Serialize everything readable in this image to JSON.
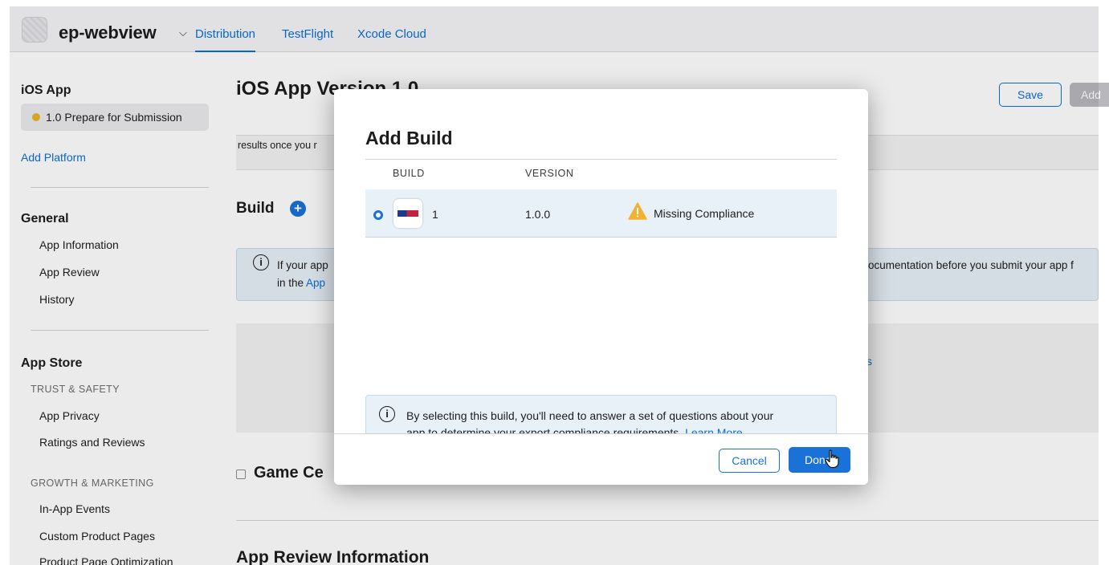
{
  "topbar": {
    "app_name": "ep-webview",
    "chevron": "⌵",
    "tabs": [
      {
        "label": "Distribution",
        "active": true
      },
      {
        "label": "TestFlight",
        "active": false
      },
      {
        "label": "Xcode Cloud",
        "active": false
      }
    ]
  },
  "sidebar": {
    "section_title": "iOS App",
    "status": "1.0 Prepare for Submission",
    "add_platform": "Add Platform",
    "general_title": "General",
    "general_items": [
      "App Information",
      "App Review",
      "History"
    ],
    "appstore_title": "App Store",
    "trust_caption": "TRUST & SAFETY",
    "trust_items": [
      "App Privacy",
      "Ratings and Reviews"
    ],
    "growth_caption": "GROWTH & MARKETING",
    "growth_items": [
      "In-App Events",
      "Custom Product Pages",
      "Product Page Optimization"
    ]
  },
  "main": {
    "title": "iOS App Version 1.0",
    "save_label": "Save",
    "add_label": "Add",
    "results_text": "results once you r",
    "build_heading": "Build",
    "build_plus": "+",
    "banner_line1_left": "If your app",
    "banner_line1_right": "ocumentation before you submit your app f",
    "banner_line2_prefix": "in the",
    "banner_line2_link": "App",
    "panel_link": "s",
    "game_center": "Game Ce",
    "app_review_info": "App Review Information"
  },
  "modal": {
    "title": "Add Build",
    "col_build": "BUILD",
    "col_version": "VERSION",
    "row": {
      "build": "1",
      "version": "1.0.0",
      "status": "Missing Compliance"
    },
    "info_line1": "By selecting this build, you'll need to answer a set of questions about your",
    "info_line2_prefix": "app to determine your export compliance requirements.",
    "info_link": "Learn More",
    "cancel_label": "Cancel",
    "done_label": "Done"
  },
  "colors": {
    "accent": "#1a72d8",
    "warning": "#f2b22e"
  }
}
